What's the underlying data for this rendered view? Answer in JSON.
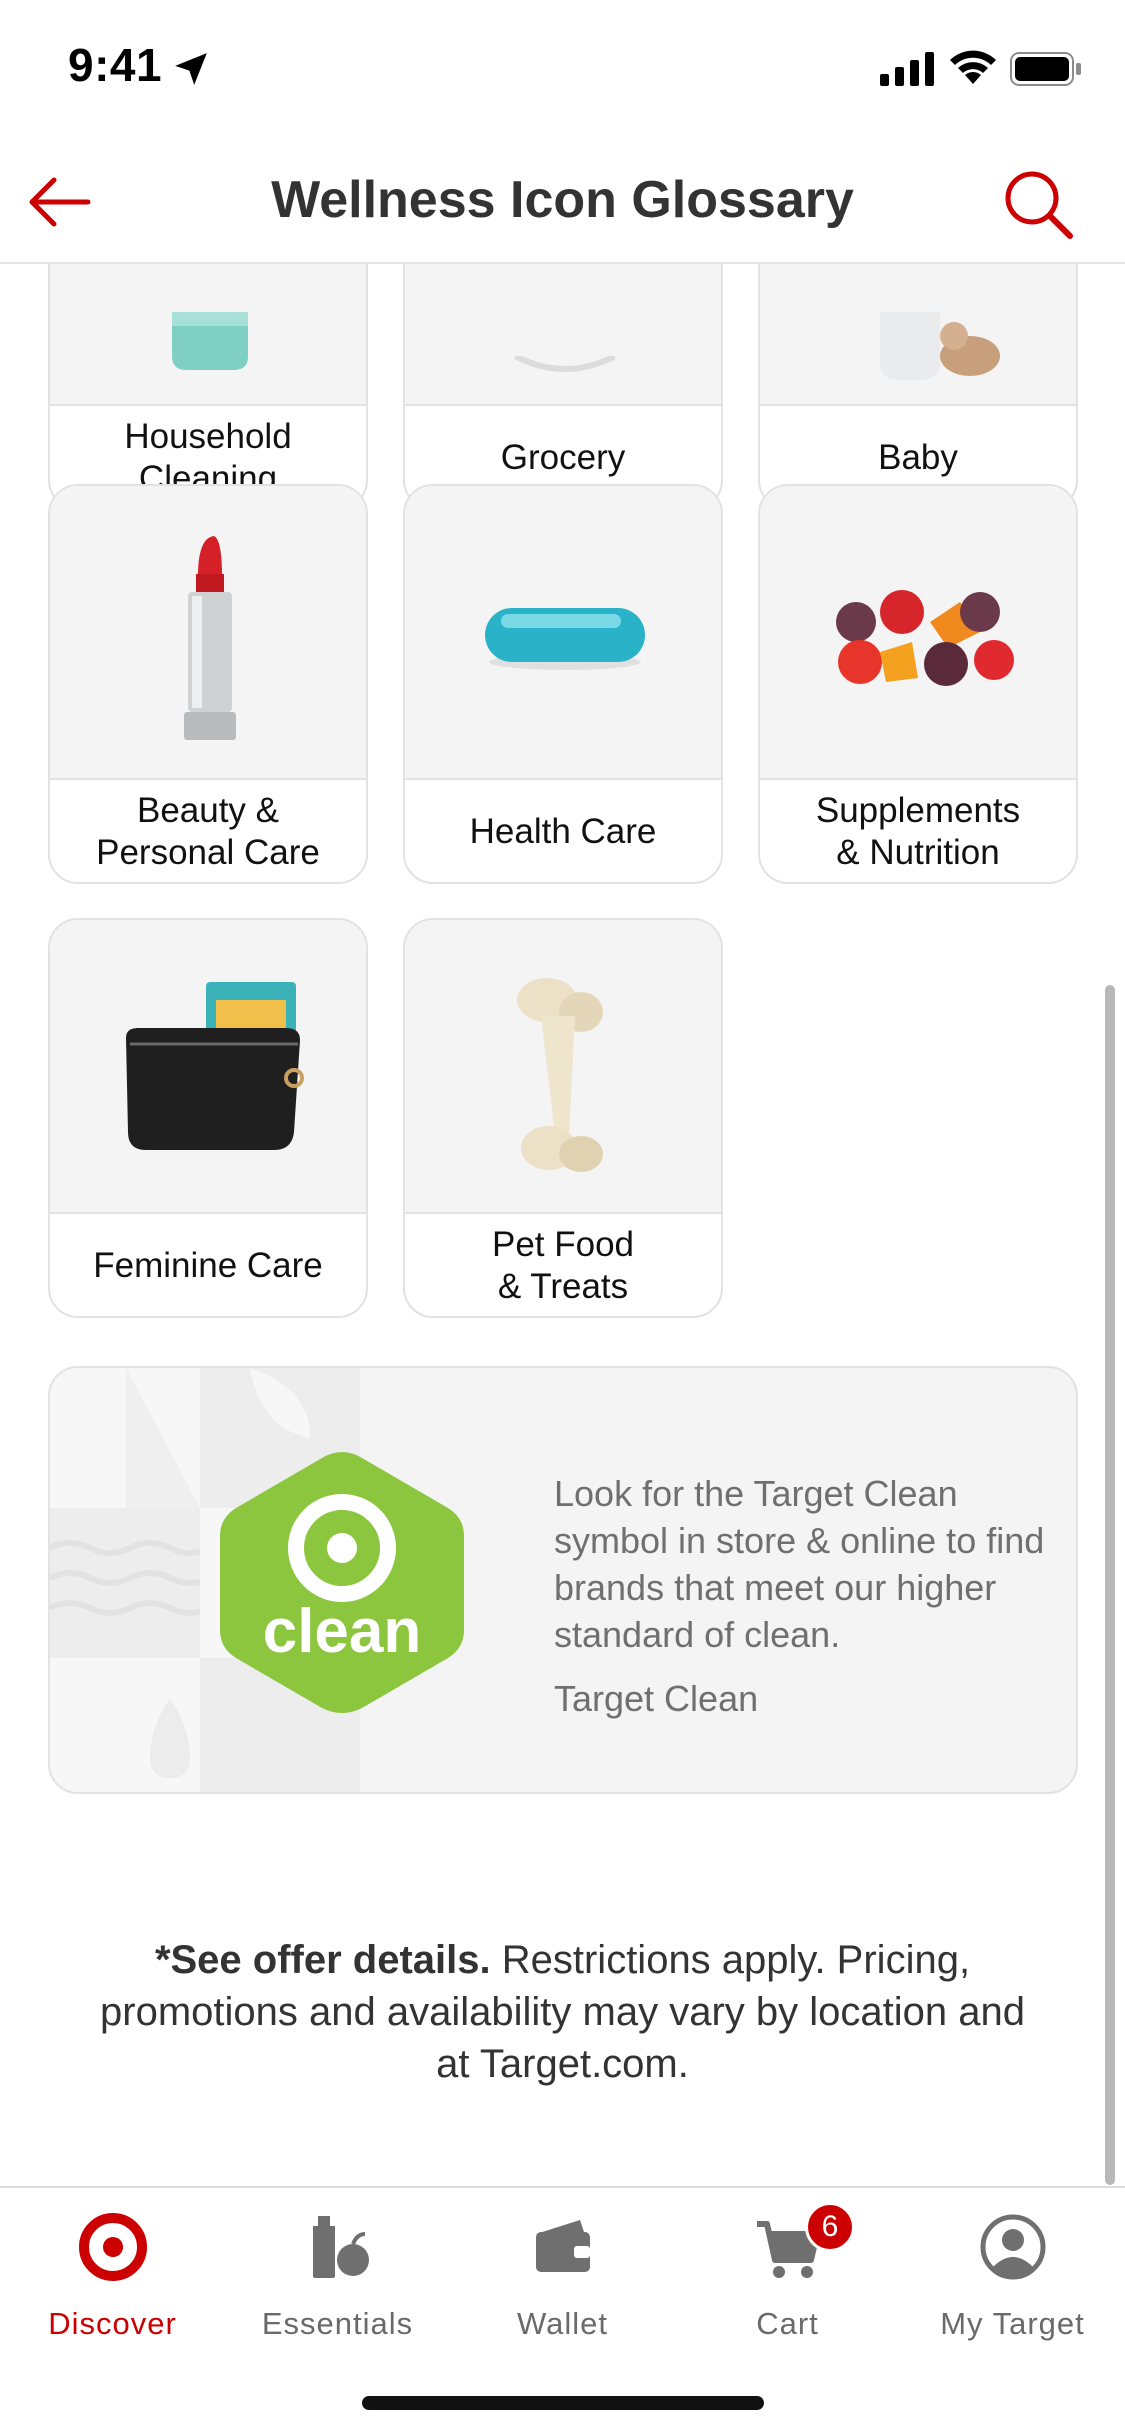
{
  "status_bar": {
    "time": "9:41"
  },
  "header": {
    "title": "Wellness Icon Glossary"
  },
  "categories": [
    {
      "label": "Household\nCleaning",
      "icon": "spray-bottle"
    },
    {
      "label": "Grocery",
      "icon": "grocery-bowl"
    },
    {
      "label": "Baby",
      "icon": "baby"
    },
    {
      "label": "Beauty &\nPersonal Care",
      "icon": "lipstick"
    },
    {
      "label": "Health Care",
      "icon": "capsule"
    },
    {
      "label": "Supplements\n& Nutrition",
      "icon": "gummies"
    },
    {
      "label": "Feminine Care",
      "icon": "pouch"
    },
    {
      "label": "Pet Food\n& Treats",
      "icon": "bone-treat"
    }
  ],
  "clean_banner": {
    "logo_text": "clean",
    "description": "Look for the Target Clean symbol in store & online to find brands that meet our higher standard of clean.",
    "link_label": "Target Clean",
    "logo_color": "#8cc63f"
  },
  "footnote": {
    "bold": "*See offer details.",
    "text": " Restrictions apply. Pricing, promotions and availability may vary by location and at Target.com."
  },
  "tabbar": {
    "tabs": [
      {
        "label": "Discover",
        "icon": "bullseye-icon",
        "active": true
      },
      {
        "label": "Essentials",
        "icon": "essentials-icon",
        "active": false
      },
      {
        "label": "Wallet",
        "icon": "wallet-icon",
        "active": false
      },
      {
        "label": "Cart",
        "icon": "cart-icon",
        "active": false
      },
      {
        "label": "My Target",
        "icon": "profile-icon",
        "active": false
      }
    ],
    "cart_count": "6"
  },
  "colors": {
    "brand_red": "#cc0000",
    "tile_bg": "#f4f4f4",
    "border": "#e2e2e2"
  }
}
